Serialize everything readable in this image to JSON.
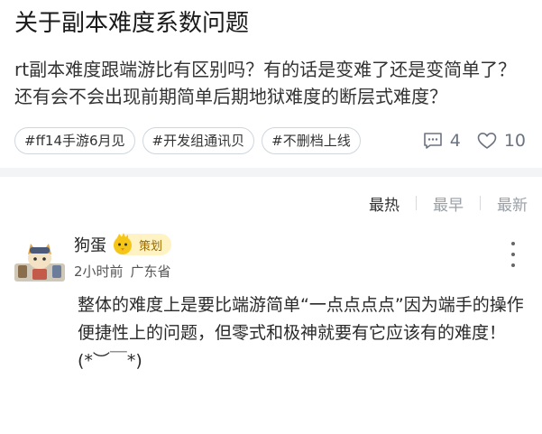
{
  "post": {
    "title": "关于副本难度系数问题",
    "body": "rt副本难度跟端游比有区别吗？有的话是变难了还是变简单了？还有会不会出现前期简单后期地狱难度的断层式难度？",
    "tags": [
      "#ff14手游6月见",
      "#开发组通讯贝",
      "#不删档上线"
    ],
    "comment_count": "4",
    "like_count": "10"
  },
  "sort": {
    "hot": "最热",
    "early": "最早",
    "new": "最新"
  },
  "comment": {
    "author": "狗蛋",
    "badge": "策划",
    "time": "2小时前",
    "location": "广东省",
    "text": "整体的难度上是要比端游简单“一点点点点”因为端手的操作便捷性上的问题，但零式和极神就要有它应该有的难度！ (*︶￣*)"
  },
  "colors": {
    "tag_border": "#cfd6dd",
    "divider": "#f3f4f6",
    "badge_bg": "#fff3c4"
  },
  "icons": {
    "comment": "comment-icon",
    "like": "heart-icon",
    "more": "more-vertical-icon"
  }
}
